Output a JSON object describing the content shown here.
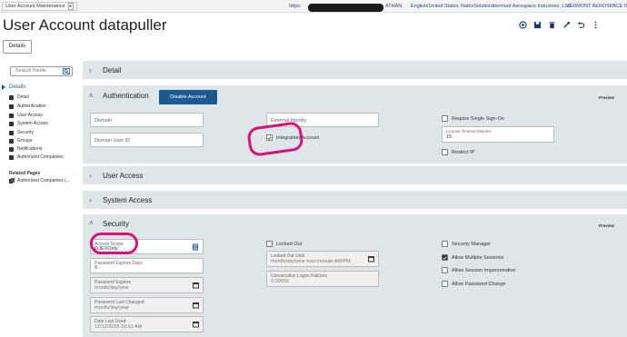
{
  "app": {
    "tab_label": "User Account Maintenance",
    "url_fragment": "https:",
    "user_fragment": "ATHAN",
    "locale": "English/United States",
    "tenant": "NatesSolutions",
    "company1": "Vermont Aerospace Industries, LLC.",
    "company2": "VERMONT AEROSPACE IND., LL"
  },
  "header": {
    "title": "User Account datapuller",
    "details_button": "Details"
  },
  "sidebar": {
    "search_placeholder": "Search Fields",
    "heading": "Details",
    "items": [
      "Detail",
      "Authentication",
      "User Access",
      "System Access",
      "Security",
      "Groups",
      "Notifications",
      "Authorized Companies"
    ],
    "related_heading": "Related Pages",
    "related_item": "Authorized Companies (..."
  },
  "sections": {
    "detail": "Detail",
    "authentication": "Authentication",
    "user_access": "User Access",
    "system_access": "System Access",
    "security": "Security",
    "preview": "Preview",
    "disable_account": "Disable Account"
  },
  "auth": {
    "domain": "Domain",
    "domain_user_id": "Domain User ID",
    "external_identity": "External Identity",
    "integration_account": "Integration Account",
    "integration_checked": true,
    "require_sso": "Require Single Sign-On",
    "license_timeout_label": "License Timeout Minutes",
    "license_timeout_value": "15",
    "restrict_ip": "Restrict IP"
  },
  "security": {
    "access_scope_label": "Access Scope",
    "access_scope_value": "OJEXOnly",
    "pwd_expires_days_label": "Password Expires Days",
    "pwd_expires_days_value": "0",
    "pwd_expires_label": "Password Expires",
    "pwd_expires_ph": "month/day/year",
    "pwd_last_changed_label": "Password Last Changed",
    "pwd_last_changed_ph": "month/day/year",
    "date_last_used_label": "Date Last Used",
    "date_last_used_value": "12/12/2025 10:51 AM",
    "locked_out": "Locked Out",
    "locked_out_until_label": "Locked Out Until",
    "locked_out_until_ph": "month/day/year hour:minute AM/PM",
    "consecutive_failures_label": "Consecutive Logon Failures",
    "consecutive_failures_value": "0.00000",
    "security_manager": "Security Manager",
    "allow_multiple_sessions": "Allow Multiple Sessions",
    "allow_multiple_checked": true,
    "allow_session_impersonation": "Allow Session Impersonation",
    "allow_password_change": "Allow Password Change"
  },
  "colors": {
    "accent": "#1a5a90",
    "panel": "#dfe6ea",
    "annotation": "#d9117f"
  }
}
